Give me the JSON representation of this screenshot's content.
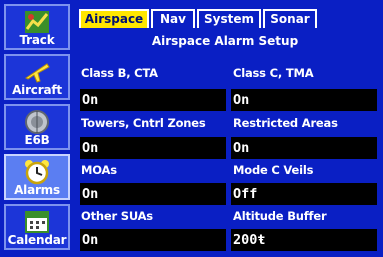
{
  "sidebar": {
    "items": [
      {
        "label": "Track",
        "icon": "track-icon"
      },
      {
        "label": "Aircraft",
        "icon": "aircraft-icon"
      },
      {
        "label": "E6B",
        "icon": "e6b-icon"
      },
      {
        "label": "Alarms",
        "icon": "alarm-clock-icon",
        "active": true
      },
      {
        "label": "Calendar",
        "icon": "calendar-icon"
      }
    ]
  },
  "tabs": [
    {
      "label": "Airspace",
      "active": true
    },
    {
      "label": "Nav"
    },
    {
      "label": "System"
    },
    {
      "label": "Sonar"
    }
  ],
  "panel": {
    "title": "Airspace Alarm Setup",
    "fields": [
      {
        "label": "Class B, CTA",
        "value": "On"
      },
      {
        "label": "Class C, TMA",
        "value": "On"
      },
      {
        "label": "Towers, Cntrl Zones",
        "value": "On"
      },
      {
        "label": "Restricted Areas",
        "value": "On"
      },
      {
        "label": "MOAs",
        "value": "On"
      },
      {
        "label": "Mode C Veils",
        "value": "Off"
      },
      {
        "label": "Other SUAs",
        "value": "On"
      },
      {
        "label": "Altitude Buffer",
        "value": "200ŧ"
      }
    ]
  },
  "colors": {
    "background": "#0a1fc4",
    "active_tab": "#ffe600",
    "active_sidebar": "#5b7ef2",
    "field_bg": "#000000",
    "text": "#ffffff"
  }
}
